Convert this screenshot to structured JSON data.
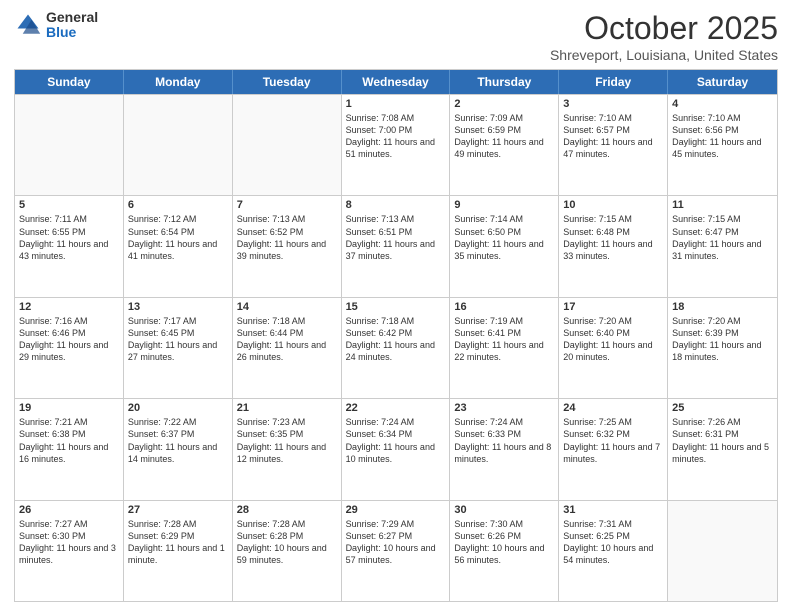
{
  "logo": {
    "general": "General",
    "blue": "Blue"
  },
  "header": {
    "month": "October 2025",
    "location": "Shreveport, Louisiana, United States"
  },
  "days": [
    "Sunday",
    "Monday",
    "Tuesday",
    "Wednesday",
    "Thursday",
    "Friday",
    "Saturday"
  ],
  "rows": [
    [
      {
        "day": "",
        "empty": true
      },
      {
        "day": "",
        "empty": true
      },
      {
        "day": "",
        "empty": true
      },
      {
        "day": "1",
        "sunrise": "Sunrise: 7:08 AM",
        "sunset": "Sunset: 7:00 PM",
        "daylight": "Daylight: 11 hours and 51 minutes."
      },
      {
        "day": "2",
        "sunrise": "Sunrise: 7:09 AM",
        "sunset": "Sunset: 6:59 PM",
        "daylight": "Daylight: 11 hours and 49 minutes."
      },
      {
        "day": "3",
        "sunrise": "Sunrise: 7:10 AM",
        "sunset": "Sunset: 6:57 PM",
        "daylight": "Daylight: 11 hours and 47 minutes."
      },
      {
        "day": "4",
        "sunrise": "Sunrise: 7:10 AM",
        "sunset": "Sunset: 6:56 PM",
        "daylight": "Daylight: 11 hours and 45 minutes."
      }
    ],
    [
      {
        "day": "5",
        "sunrise": "Sunrise: 7:11 AM",
        "sunset": "Sunset: 6:55 PM",
        "daylight": "Daylight: 11 hours and 43 minutes."
      },
      {
        "day": "6",
        "sunrise": "Sunrise: 7:12 AM",
        "sunset": "Sunset: 6:54 PM",
        "daylight": "Daylight: 11 hours and 41 minutes."
      },
      {
        "day": "7",
        "sunrise": "Sunrise: 7:13 AM",
        "sunset": "Sunset: 6:52 PM",
        "daylight": "Daylight: 11 hours and 39 minutes."
      },
      {
        "day": "8",
        "sunrise": "Sunrise: 7:13 AM",
        "sunset": "Sunset: 6:51 PM",
        "daylight": "Daylight: 11 hours and 37 minutes."
      },
      {
        "day": "9",
        "sunrise": "Sunrise: 7:14 AM",
        "sunset": "Sunset: 6:50 PM",
        "daylight": "Daylight: 11 hours and 35 minutes."
      },
      {
        "day": "10",
        "sunrise": "Sunrise: 7:15 AM",
        "sunset": "Sunset: 6:48 PM",
        "daylight": "Daylight: 11 hours and 33 minutes."
      },
      {
        "day": "11",
        "sunrise": "Sunrise: 7:15 AM",
        "sunset": "Sunset: 6:47 PM",
        "daylight": "Daylight: 11 hours and 31 minutes."
      }
    ],
    [
      {
        "day": "12",
        "sunrise": "Sunrise: 7:16 AM",
        "sunset": "Sunset: 6:46 PM",
        "daylight": "Daylight: 11 hours and 29 minutes."
      },
      {
        "day": "13",
        "sunrise": "Sunrise: 7:17 AM",
        "sunset": "Sunset: 6:45 PM",
        "daylight": "Daylight: 11 hours and 27 minutes."
      },
      {
        "day": "14",
        "sunrise": "Sunrise: 7:18 AM",
        "sunset": "Sunset: 6:44 PM",
        "daylight": "Daylight: 11 hours and 26 minutes."
      },
      {
        "day": "15",
        "sunrise": "Sunrise: 7:18 AM",
        "sunset": "Sunset: 6:42 PM",
        "daylight": "Daylight: 11 hours and 24 minutes."
      },
      {
        "day": "16",
        "sunrise": "Sunrise: 7:19 AM",
        "sunset": "Sunset: 6:41 PM",
        "daylight": "Daylight: 11 hours and 22 minutes."
      },
      {
        "day": "17",
        "sunrise": "Sunrise: 7:20 AM",
        "sunset": "Sunset: 6:40 PM",
        "daylight": "Daylight: 11 hours and 20 minutes."
      },
      {
        "day": "18",
        "sunrise": "Sunrise: 7:20 AM",
        "sunset": "Sunset: 6:39 PM",
        "daylight": "Daylight: 11 hours and 18 minutes."
      }
    ],
    [
      {
        "day": "19",
        "sunrise": "Sunrise: 7:21 AM",
        "sunset": "Sunset: 6:38 PM",
        "daylight": "Daylight: 11 hours and 16 minutes."
      },
      {
        "day": "20",
        "sunrise": "Sunrise: 7:22 AM",
        "sunset": "Sunset: 6:37 PM",
        "daylight": "Daylight: 11 hours and 14 minutes."
      },
      {
        "day": "21",
        "sunrise": "Sunrise: 7:23 AM",
        "sunset": "Sunset: 6:35 PM",
        "daylight": "Daylight: 11 hours and 12 minutes."
      },
      {
        "day": "22",
        "sunrise": "Sunrise: 7:24 AM",
        "sunset": "Sunset: 6:34 PM",
        "daylight": "Daylight: 11 hours and 10 minutes."
      },
      {
        "day": "23",
        "sunrise": "Sunrise: 7:24 AM",
        "sunset": "Sunset: 6:33 PM",
        "daylight": "Daylight: 11 hours and 8 minutes."
      },
      {
        "day": "24",
        "sunrise": "Sunrise: 7:25 AM",
        "sunset": "Sunset: 6:32 PM",
        "daylight": "Daylight: 11 hours and 7 minutes."
      },
      {
        "day": "25",
        "sunrise": "Sunrise: 7:26 AM",
        "sunset": "Sunset: 6:31 PM",
        "daylight": "Daylight: 11 hours and 5 minutes."
      }
    ],
    [
      {
        "day": "26",
        "sunrise": "Sunrise: 7:27 AM",
        "sunset": "Sunset: 6:30 PM",
        "daylight": "Daylight: 11 hours and 3 minutes."
      },
      {
        "day": "27",
        "sunrise": "Sunrise: 7:28 AM",
        "sunset": "Sunset: 6:29 PM",
        "daylight": "Daylight: 11 hours and 1 minute."
      },
      {
        "day": "28",
        "sunrise": "Sunrise: 7:28 AM",
        "sunset": "Sunset: 6:28 PM",
        "daylight": "Daylight: 10 hours and 59 minutes."
      },
      {
        "day": "29",
        "sunrise": "Sunrise: 7:29 AM",
        "sunset": "Sunset: 6:27 PM",
        "daylight": "Daylight: 10 hours and 57 minutes."
      },
      {
        "day": "30",
        "sunrise": "Sunrise: 7:30 AM",
        "sunset": "Sunset: 6:26 PM",
        "daylight": "Daylight: 10 hours and 56 minutes."
      },
      {
        "day": "31",
        "sunrise": "Sunrise: 7:31 AM",
        "sunset": "Sunset: 6:25 PM",
        "daylight": "Daylight: 10 hours and 54 minutes."
      },
      {
        "day": "",
        "empty": true
      }
    ]
  ]
}
